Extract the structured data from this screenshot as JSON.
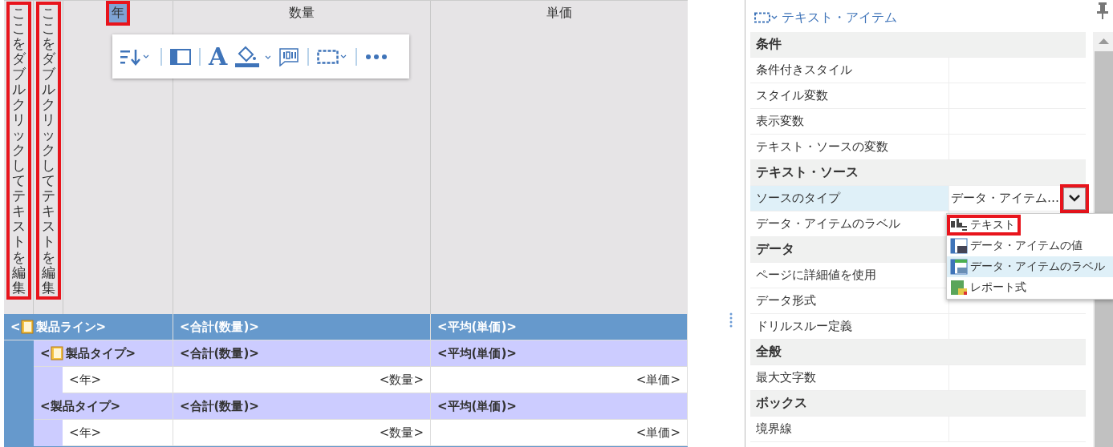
{
  "report": {
    "header_cells": [
      {
        "kind": "vertical",
        "text": "ここをダブルクリックしてテキストを編集",
        "highlighted": true,
        "selected": false
      },
      {
        "kind": "vertical",
        "text": "ここをダブルクリックしてテキストを編集",
        "highlighted": true,
        "selected": false
      },
      {
        "kind": "title",
        "text": "年",
        "highlighted": true,
        "selected": true
      },
      {
        "kind": "title",
        "text": "数量",
        "highlighted": false,
        "selected": false
      },
      {
        "kind": "title",
        "text": "単価",
        "highlighted": false,
        "selected": false
      }
    ],
    "toolbar": {
      "font_glyph": "A"
    },
    "groups": [
      {
        "label": "<製品ライン>",
        "icon": true,
        "cells": [
          "<合計(数量)>",
          "<平均(単価)>"
        ],
        "children": [
          {
            "label": "<製品タイプ>",
            "icon": true,
            "cells": [
              "<合計(数量)>",
              "<平均(単価)>"
            ],
            "children": [
              {
                "label": "<年>",
                "cells": [
                  "<数量>",
                  "<単価>"
                ]
              }
            ]
          },
          {
            "label": "<製品タイプ>",
            "icon": false,
            "cells": [
              "<合計(数量)>",
              "<平均(単価)>"
            ],
            "children": [
              {
                "label": "<年>",
                "cells": [
                  "<数量>",
                  "<単価>"
                ]
              }
            ]
          }
        ]
      }
    ]
  },
  "properties": {
    "title": "テキスト・アイテム",
    "sections": [
      {
        "title": "条件",
        "rows": [
          {
            "label": "条件付きスタイル",
            "selected": false
          },
          {
            "label": "スタイル変数",
            "selected": false
          },
          {
            "label": "表示変数",
            "selected": false
          },
          {
            "label": "テキスト・ソースの変数",
            "selected": false
          }
        ]
      },
      {
        "title": "テキスト・ソース",
        "rows": [
          {
            "label": "ソースのタイプ",
            "selected": true,
            "value": "データ・アイテム…",
            "dropdown_highlighted": true
          },
          {
            "label": "データ・アイテムのラベル",
            "selected": false
          }
        ]
      },
      {
        "title": "データ",
        "rows": [
          {
            "label": "ページに詳細値を使用",
            "selected": false
          },
          {
            "label": "データ形式",
            "selected": false
          },
          {
            "label": "ドリルスルー定義",
            "selected": false
          }
        ]
      },
      {
        "title": "全般",
        "rows": [
          {
            "label": "最大文字数",
            "selected": false
          }
        ]
      },
      {
        "title": "ボックス",
        "rows": [
          {
            "label": "境界線",
            "selected": false
          }
        ]
      }
    ],
    "menu": [
      {
        "label": "テキスト",
        "kind": "text",
        "selected": false,
        "highlighted": true
      },
      {
        "label": "データ・アイテムの値",
        "kind": "value",
        "selected": false,
        "highlighted": false
      },
      {
        "label": "データ・アイテムのラベル",
        "kind": "label",
        "selected": true,
        "highlighted": false
      },
      {
        "label": "レポート式",
        "kind": "expression",
        "selected": false,
        "highlighted": false
      }
    ]
  }
}
